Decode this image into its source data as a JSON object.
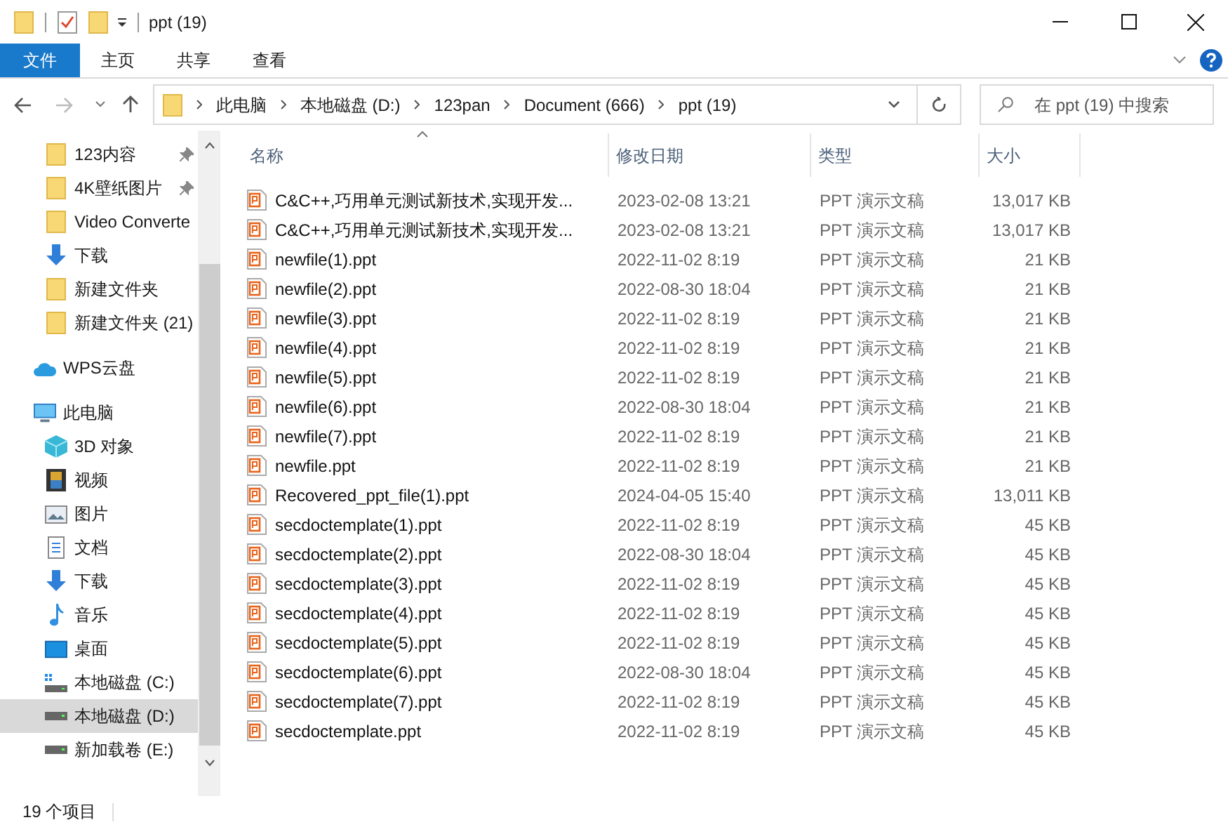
{
  "window": {
    "title": "ppt (19)"
  },
  "ribbon_tabs": [
    {
      "label": "文件",
      "selected": true
    },
    {
      "label": "主页",
      "selected": false
    },
    {
      "label": "共享",
      "selected": false
    },
    {
      "label": "查看",
      "selected": false
    }
  ],
  "address": {
    "crumbs": [
      "此电脑",
      "本地磁盘 (D:)",
      "123pan",
      "Document (666)",
      "ppt (19)"
    ]
  },
  "search": {
    "placeholder": "在 ppt (19) 中搜索"
  },
  "sidebar": {
    "quick_items": [
      {
        "label": "123内容",
        "kind": "folder",
        "pinned": true,
        "selected": false
      },
      {
        "label": "4K壁纸图片",
        "kind": "folder",
        "pinned": true,
        "selected": false
      },
      {
        "label": "Video Converte",
        "kind": "folder",
        "pinned": false,
        "selected": false
      },
      {
        "label": "下载",
        "kind": "download",
        "pinned": false,
        "selected": false
      },
      {
        "label": "新建文件夹",
        "kind": "folder",
        "pinned": false,
        "selected": false
      },
      {
        "label": "新建文件夹 (21)",
        "kind": "folder",
        "pinned": false,
        "selected": false
      }
    ],
    "items": [
      {
        "label": "WPS云盘",
        "kind": "cloud",
        "selected": false
      },
      {
        "label": "此电脑",
        "kind": "pc",
        "selected": false,
        "children": [
          {
            "label": "3D 对象",
            "kind": "cube",
            "selected": false
          },
          {
            "label": "视频",
            "kind": "video",
            "selected": false
          },
          {
            "label": "图片",
            "kind": "image",
            "selected": false
          },
          {
            "label": "文档",
            "kind": "doc",
            "selected": false
          },
          {
            "label": "下载",
            "kind": "download",
            "selected": false
          },
          {
            "label": "音乐",
            "kind": "music",
            "selected": false
          },
          {
            "label": "桌面",
            "kind": "desktop",
            "selected": false
          },
          {
            "label": "本地磁盘 (C:)",
            "kind": "drive_c",
            "selected": false
          },
          {
            "label": "本地磁盘 (D:)",
            "kind": "drive",
            "selected": true
          },
          {
            "label": "新加载卷 (E:)",
            "kind": "drive",
            "selected": false
          }
        ]
      }
    ]
  },
  "table": {
    "columns": [
      "名称",
      "修改日期",
      "类型",
      "大小"
    ],
    "rows": [
      [
        "C&C++,巧用单元测试新技术,实现开发...",
        "2023-02-08 13:21",
        "PPT 演示文稿",
        "13,017 KB"
      ],
      [
        "C&C++,巧用单元测试新技术,实现开发...",
        "2023-02-08 13:21",
        "PPT 演示文稿",
        "13,017 KB"
      ],
      [
        "newfile(1).ppt",
        "2022-11-02 8:19",
        "PPT 演示文稿",
        "21 KB"
      ],
      [
        "newfile(2).ppt",
        "2022-08-30 18:04",
        "PPT 演示文稿",
        "21 KB"
      ],
      [
        "newfile(3).ppt",
        "2022-11-02 8:19",
        "PPT 演示文稿",
        "21 KB"
      ],
      [
        "newfile(4).ppt",
        "2022-11-02 8:19",
        "PPT 演示文稿",
        "21 KB"
      ],
      [
        "newfile(5).ppt",
        "2022-11-02 8:19",
        "PPT 演示文稿",
        "21 KB"
      ],
      [
        "newfile(6).ppt",
        "2022-08-30 18:04",
        "PPT 演示文稿",
        "21 KB"
      ],
      [
        "newfile(7).ppt",
        "2022-11-02 8:19",
        "PPT 演示文稿",
        "21 KB"
      ],
      [
        "newfile.ppt",
        "2022-11-02 8:19",
        "PPT 演示文稿",
        "21 KB"
      ],
      [
        "Recovered_ppt_file(1).ppt",
        "2024-04-05 15:40",
        "PPT 演示文稿",
        "13,011 KB"
      ],
      [
        "secdoctemplate(1).ppt",
        "2022-11-02 8:19",
        "PPT 演示文稿",
        "45 KB"
      ],
      [
        "secdoctemplate(2).ppt",
        "2022-08-30 18:04",
        "PPT 演示文稿",
        "45 KB"
      ],
      [
        "secdoctemplate(3).ppt",
        "2022-11-02 8:19",
        "PPT 演示文稿",
        "45 KB"
      ],
      [
        "secdoctemplate(4).ppt",
        "2022-11-02 8:19",
        "PPT 演示文稿",
        "45 KB"
      ],
      [
        "secdoctemplate(5).ppt",
        "2022-11-02 8:19",
        "PPT 演示文稿",
        "45 KB"
      ],
      [
        "secdoctemplate(6).ppt",
        "2022-08-30 18:04",
        "PPT 演示文稿",
        "45 KB"
      ],
      [
        "secdoctemplate(7).ppt",
        "2022-11-02 8:19",
        "PPT 演示文稿",
        "45 KB"
      ],
      [
        "secdoctemplate.ppt",
        "2022-11-02 8:19",
        "PPT 演示文稿",
        "45 KB"
      ]
    ]
  },
  "status_bar": {
    "count": "19 个项目"
  }
}
